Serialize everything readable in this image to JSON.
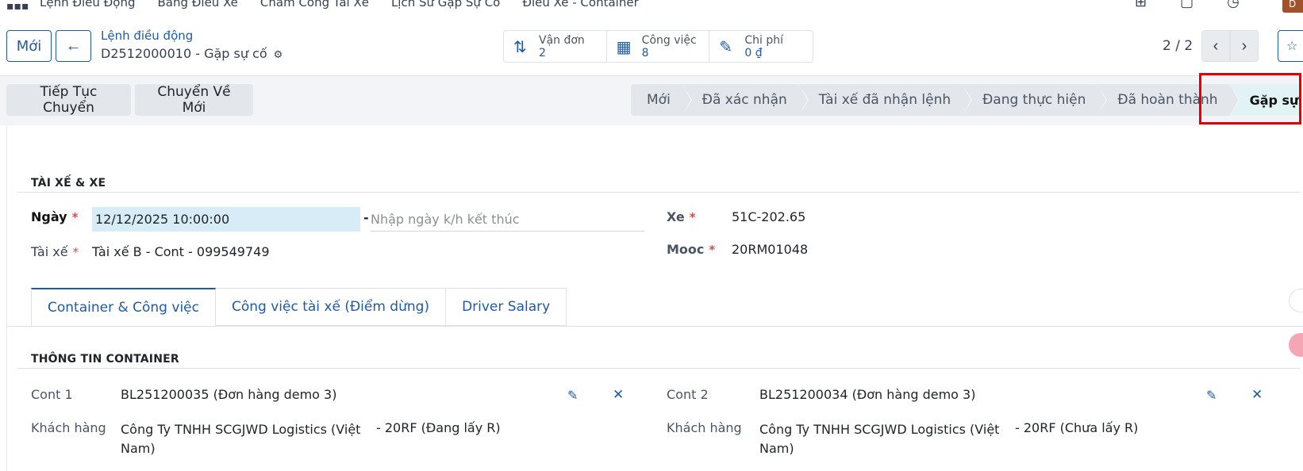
{
  "topnav": {
    "menu": [
      "Lệnh Điều Động",
      "Bảng Điều Xe",
      "Chấm Công Tài Xế",
      "Lịch Sử Gặp Sự Cố",
      "Điều Xe - Container"
    ],
    "avatar": "D"
  },
  "control_panel": {
    "new_label": "Mới",
    "breadcrumb_parent": "Lệnh điều động",
    "breadcrumb_current": "D2512000010 - Gặp sự cố",
    "smart_buttons": [
      {
        "label": "Vận đơn",
        "value": "2",
        "icon": "transfer-icon"
      },
      {
        "label": "Công việc",
        "value": "8",
        "icon": "calendar-icon"
      },
      {
        "label": "Chi phí",
        "value": "0 ₫",
        "icon": "edit-doc-icon"
      }
    ],
    "pager": "2 / 2"
  },
  "statusbar": {
    "actions": [
      "Tiếp Tục Chuyển",
      "Chuyển Về Mới"
    ],
    "stages": [
      "Mới",
      "Đã xác nhận",
      "Tài xế đã nhận lệnh",
      "Đang thực hiện",
      "Đã hoàn thành",
      "Gặp sự cố"
    ],
    "active_stage": "Gặp sự cố"
  },
  "form": {
    "section_driver": "TÀI XẾ & XE",
    "date_label": "Ngày",
    "date_value": "12/12/2025 10:00:00",
    "end_date_placeholder": "Nhập ngày k/h kết thúc",
    "driver_label": "Tài xế",
    "driver_value": "Tài xế B - Cont - 099549749",
    "vehicle_label": "Xe",
    "vehicle_value": "51C-202.65",
    "trailer_label": "Mooc",
    "trailer_value": "20RM01048",
    "tabs": [
      "Container & Công việc",
      "Công việc tài xế (Điểm dừng)",
      "Driver Salary"
    ],
    "section_container": "THÔNG TIN CONTAINER",
    "cont1_label": "Cont 1",
    "cont1_value": "BL251200035 (Đơn hàng demo 3)",
    "cont1_customer_label": "Khách hàng",
    "cont1_customer": "Công Ty TNHH SCGJWD Logistics (Việt Nam)",
    "cont1_type": "20RF (Đang lấy R)",
    "cont2_label": "Cont 2",
    "cont2_value": "BL251200034 (Đơn hàng demo 3)",
    "cont2_customer_label": "Khách hàng",
    "cont2_customer": "Công Ty TNHH SCGJWD Logistics (Việt Nam)",
    "cont2_type": "20RF (Chưa lấy R)"
  },
  "colors": {
    "primary": "#1e5aa8",
    "active_stage_bg": "#e1f3f4",
    "highlight": "#e20000",
    "required": "#e0494b"
  }
}
